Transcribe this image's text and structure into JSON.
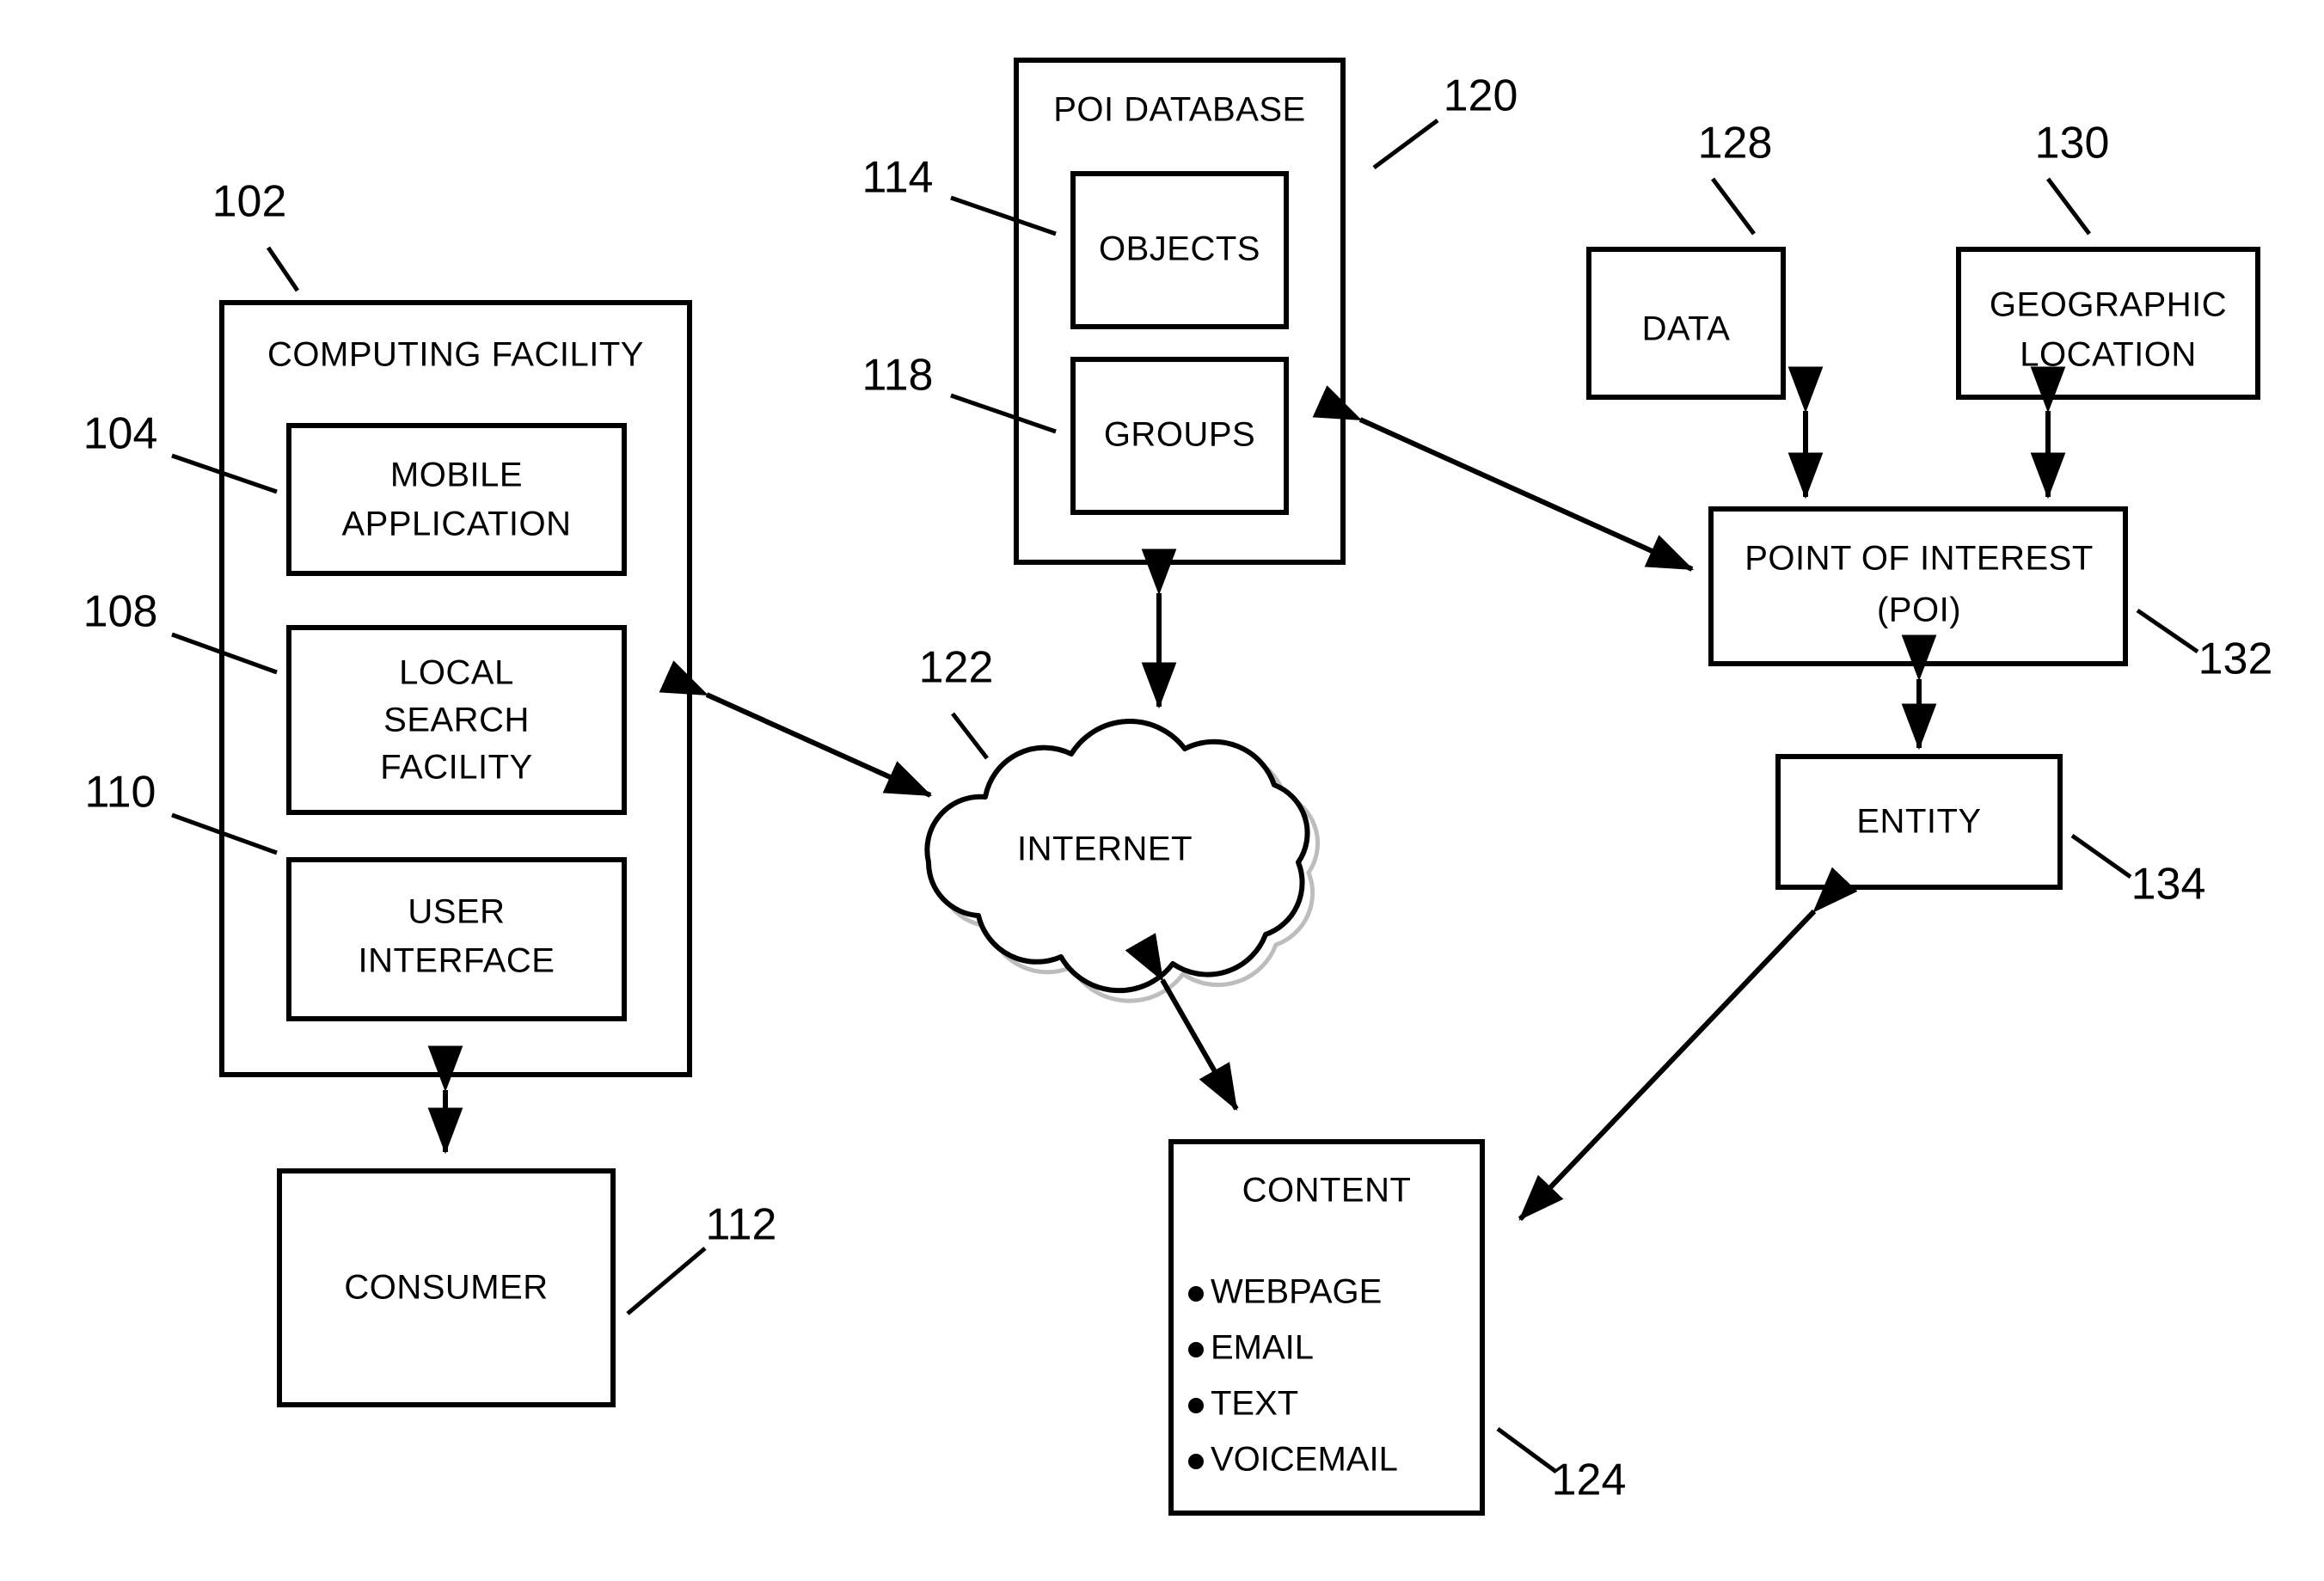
{
  "diagram": {
    "title": "POI local search system block diagram",
    "stroke_color": "#000000",
    "background_color": "#ffffff"
  },
  "nodes": {
    "computing_facility": {
      "label": "COMPUTING FACILITY",
      "ref": "102"
    },
    "mobile_application": {
      "label_line1": "MOBILE",
      "label_line2": "APPLICATION",
      "ref": "104"
    },
    "local_search_facility": {
      "label_line1": "LOCAL",
      "label_line2": "SEARCH",
      "label_line3": "FACILITY",
      "ref": "108"
    },
    "user_interface": {
      "label_line1": "USER",
      "label_line2": "INTERFACE",
      "ref": "110"
    },
    "consumer": {
      "label": "CONSUMER",
      "ref": "112"
    },
    "poi_database": {
      "label": "POI DATABASE",
      "ref": "120"
    },
    "objects": {
      "label": "OBJECTS",
      "ref": "114"
    },
    "groups": {
      "label": "GROUPS",
      "ref": "118"
    },
    "internet": {
      "label": "INTERNET",
      "ref": "122"
    },
    "content": {
      "label": "CONTENT",
      "ref": "124",
      "items": [
        "WEBPAGE",
        "EMAIL",
        "TEXT",
        "VOICEMAIL"
      ]
    },
    "data": {
      "label": "DATA",
      "ref": "128"
    },
    "geographic_location": {
      "label_line1": "GEOGRAPHIC",
      "label_line2": "LOCATION",
      "ref": "130"
    },
    "point_of_interest": {
      "label_line1": "POINT OF INTEREST",
      "label_line2": "(POI)",
      "ref": "132"
    },
    "entity": {
      "label": "ENTITY",
      "ref": "134"
    }
  },
  "connections": [
    {
      "from": "computing_facility",
      "to": "consumer",
      "type": "bidirectional"
    },
    {
      "from": "computing_facility",
      "to": "internet",
      "type": "bidirectional"
    },
    {
      "from": "poi_database",
      "to": "internet",
      "type": "bidirectional"
    },
    {
      "from": "internet",
      "to": "content",
      "type": "bidirectional"
    },
    {
      "from": "poi_database",
      "to": "point_of_interest",
      "type": "bidirectional"
    },
    {
      "from": "data",
      "to": "point_of_interest",
      "type": "bidirectional"
    },
    {
      "from": "geographic_location",
      "to": "point_of_interest",
      "type": "bidirectional"
    },
    {
      "from": "point_of_interest",
      "to": "entity",
      "type": "bidirectional"
    },
    {
      "from": "entity",
      "to": "content",
      "type": "bidirectional"
    }
  ]
}
